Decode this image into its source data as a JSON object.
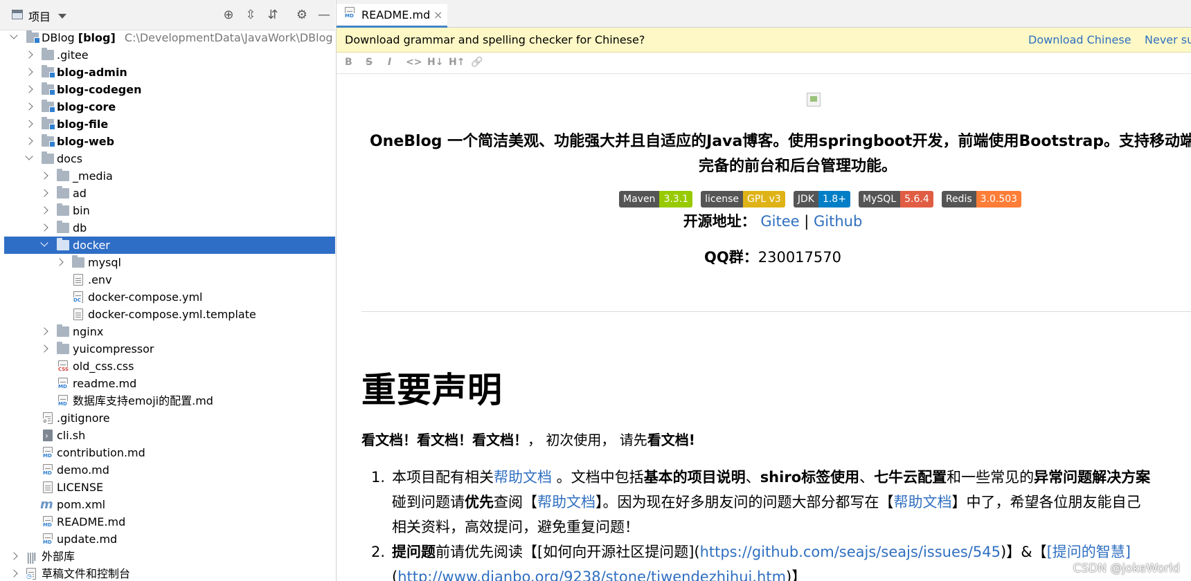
{
  "left_panel": {
    "title": "项目",
    "rows": [
      {
        "label": "DBlog",
        "extra": "[blog]",
        "path": "C:\\DevelopmentData\\JavaWork\\DBlog"
      },
      {
        "label": ".gitee"
      },
      {
        "label": "blog-admin"
      },
      {
        "label": "blog-codegen"
      },
      {
        "label": "blog-core"
      },
      {
        "label": "blog-file"
      },
      {
        "label": "blog-web"
      },
      {
        "label": "docs"
      },
      {
        "label": "_media"
      },
      {
        "label": "ad"
      },
      {
        "label": "bin"
      },
      {
        "label": "db"
      },
      {
        "label": "docker"
      },
      {
        "label": "mysql"
      },
      {
        "label": ".env"
      },
      {
        "label": "docker-compose.yml"
      },
      {
        "label": "docker-compose.yml.template"
      },
      {
        "label": "nginx"
      },
      {
        "label": "yuicompressor"
      },
      {
        "label": "old_css.css"
      },
      {
        "label": "readme.md"
      },
      {
        "label": "数据库支持emoji的配置.md"
      },
      {
        "label": ".gitignore"
      },
      {
        "label": "cli.sh"
      },
      {
        "label": "contribution.md"
      },
      {
        "label": "demo.md"
      },
      {
        "label": "LICENSE"
      },
      {
        "label": "pom.xml"
      },
      {
        "label": "README.md"
      },
      {
        "label": "update.md"
      },
      {
        "label": "外部库"
      },
      {
        "label": "草稿文件和控制台"
      }
    ]
  },
  "editor": {
    "tab_label": "README.md",
    "banner": {
      "message": "Download grammar and spelling checker for Chinese?",
      "download": "Download Chinese",
      "never": "Never su"
    },
    "toolbar": [
      "B",
      "S",
      "I",
      "<>",
      "H↓",
      "H↑",
      "🔗"
    ],
    "intro_line1": "OneBlog 一个简洁美观、功能强大并且自适应的Java博客。使用springboot开发，前端使用Bootstrap。支持移动端自适",
    "intro_line2": "完备的前台和后台管理功能。",
    "badges": [
      {
        "key": "Maven",
        "value": "3.3.1",
        "color": "#97ca00"
      },
      {
        "key": "license",
        "value": "GPL v3",
        "color": "#dfb317"
      },
      {
        "key": "JDK",
        "value": "1.8+",
        "color": "#007ec6"
      },
      {
        "key": "MySQL",
        "value": "5.6.4",
        "color": "#e05d44"
      },
      {
        "key": "Redis",
        "value": "3.0.503",
        "color": "#fe7d37"
      }
    ],
    "source_label": "开源地址：",
    "gitee": "Gitee",
    "sep": "|",
    "github": "Github",
    "qq_label": "QQ群：",
    "qq_value": "230017570",
    "heading": "重要声明",
    "p1_b1": "看文档！看文档！看文档！",
    "p1_t1": "， 初次使用， 请先",
    "p1_b2": "看文档!",
    "li1_num": "1.",
    "li1_l1_t1": "本项目配有相关",
    "li1_l1_a1": "帮助文档",
    "li1_l1_t2": " 。文档中包括",
    "li1_l1_b1": "基本的项目说明",
    "li1_l1_t3": "、",
    "li1_l1_b2": "shiro标签使用",
    "li1_l1_t4": "、",
    "li1_l1_b3": "七牛云配置",
    "li1_l1_t5": "和一些常见的",
    "li1_l1_b4": "异常问题解决方案",
    "li1_l2_t1": "碰到问题请",
    "li1_l2_b1": "优先",
    "li1_l2_t2": "查阅【",
    "li1_l2_a1": "帮助文档",
    "li1_l2_t3": "】。因为现在好多朋友问的问题大部分都写在【",
    "li1_l2_a2": "帮助文档",
    "li1_l2_t4": "】中了，希望各位朋友能自己",
    "li1_l3": "相关资料，高效提问，避免重复问题！",
    "li2_num": "2.",
    "li2_l1_b1": "提问题",
    "li2_l1_t1": "前请优先阅读【[如何向开源社区提问题](",
    "li2_l1_a1": "https://github.com/seajs/seajs/issues/545",
    "li2_l1_t2": ")】&【",
    "li2_l1_a2": "[提问的智慧]",
    "li2_l2_t1": "(",
    "li2_l2_a1": "http://www.dianbo.org/9238/stone/tiwendezhihui.htm",
    "li2_l2_t2": ")】",
    "watermark": "CSDN @jokeWorld"
  }
}
